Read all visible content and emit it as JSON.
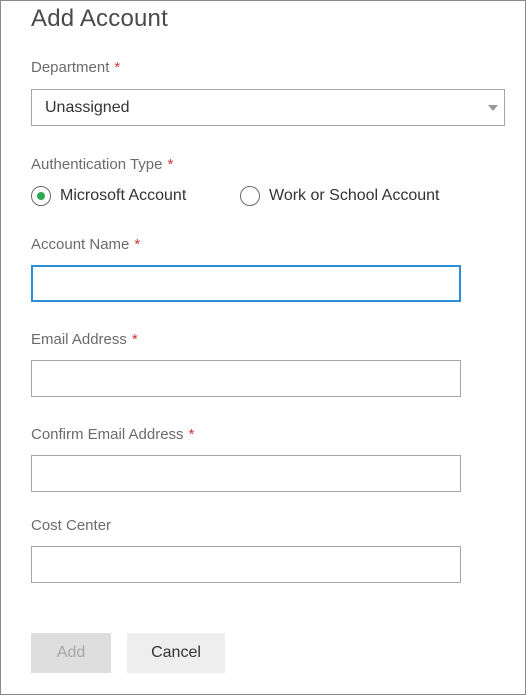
{
  "dialog": {
    "title": "Add Account"
  },
  "colors": {
    "required": "#d13438",
    "radio_selected": "#2fa84f",
    "focus_border": "#2b8fd8",
    "disabled_button_bg": "#dedede"
  },
  "form": {
    "required_marker": "*",
    "department": {
      "label": "Department",
      "required": true,
      "selected_value": "Unassigned"
    },
    "authentication_type": {
      "label": "Authentication Type",
      "required": true,
      "options": [
        {
          "label": "Microsoft Account",
          "selected": true
        },
        {
          "label": "Work or School Account",
          "selected": false
        }
      ]
    },
    "account_name": {
      "label": "Account Name",
      "required": true,
      "value": "",
      "focused": true
    },
    "email_address": {
      "label": "Email Address",
      "required": true,
      "value": ""
    },
    "confirm_email_address": {
      "label": "Confirm Email Address",
      "required": true,
      "value": ""
    },
    "cost_center": {
      "label": "Cost Center",
      "required": false,
      "value": ""
    }
  },
  "buttons": {
    "add_label": "Add",
    "add_disabled": true,
    "cancel_label": "Cancel"
  }
}
